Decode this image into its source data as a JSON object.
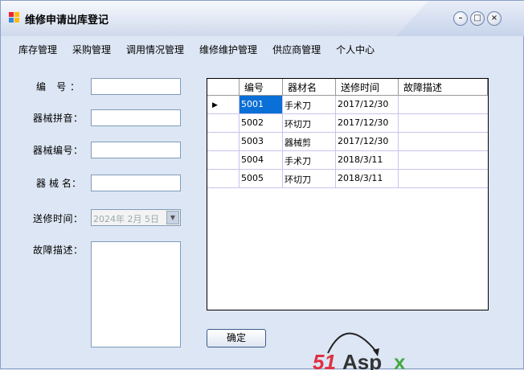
{
  "window": {
    "title": "维修申请出库登记",
    "minimize": "–",
    "maximize": "□",
    "close": "×"
  },
  "menu": [
    "库存管理",
    "采购管理",
    "调用情况管理",
    "维修维护管理",
    "供应商管理",
    "个人中心"
  ],
  "form": {
    "id_label": "编 号：",
    "pinyin_label": "器械拼音：",
    "code_label": "器械编号：",
    "name_label": "器 械 名：",
    "date_label": "送修时间：",
    "date_value": "2024年 2月 5日",
    "desc_label": "故障描述："
  },
  "grid": {
    "headers": [
      "编号",
      "器材名",
      "送修时间",
      "故障描述"
    ],
    "rows": [
      [
        "5001",
        "手术刀",
        "2017/12/30",
        ""
      ],
      [
        "5002",
        "环切刀",
        "2017/12/30",
        ""
      ],
      [
        "5003",
        "器械剪",
        "2017/12/30",
        ""
      ],
      [
        "5004",
        "手术刀",
        "2018/3/11",
        ""
      ],
      [
        "5005",
        "环切刀",
        "2018/3/11",
        ""
      ]
    ]
  },
  "confirm_label": "确定",
  "logo_text": "51Aspx"
}
